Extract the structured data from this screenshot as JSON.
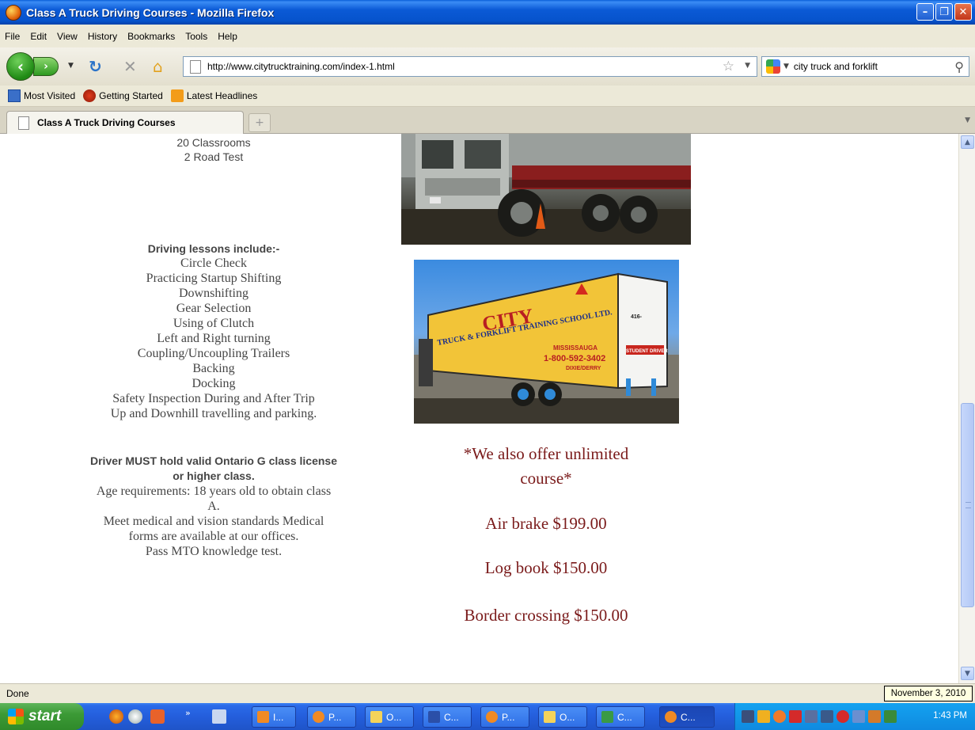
{
  "window": {
    "title": "Class A Truck Driving Courses - Mozilla Firefox"
  },
  "menu": [
    "File",
    "Edit",
    "View",
    "History",
    "Bookmarks",
    "Tools",
    "Help"
  ],
  "nav": {
    "url": "http://www.citytrucktraining.com/index-1.html",
    "search_value": "city truck and forklift"
  },
  "bookmarks": [
    "Most Visited",
    "Getting Started",
    "Latest Headlines"
  ],
  "tab": {
    "label": "Class A Truck Driving Courses"
  },
  "page": {
    "header_lines": [
      "20 Classrooms",
      "2 Road Test"
    ],
    "lessons_title": "Driving lessons include:-",
    "lessons": [
      "Circle Check",
      "Practicing Startup Shifting",
      "Downshifting",
      "Gear Selection",
      "Using of Clutch",
      "Left and Right turning",
      "Coupling/Uncoupling Trailers",
      "Backing",
      "Docking",
      "Safety Inspection During and After Trip",
      "Up and Downhill travelling and parking."
    ],
    "req_bold_1": "Driver MUST hold valid Ontario G class license",
    "req_bold_2": "or higher class.",
    "req_lines": [
      "Age requirements: 18 years old to obtain class",
      "A.",
      "Meet medical and vision standards Medical",
      "forms are available at our offices.",
      "Pass MTO knowledge test."
    ],
    "offer_line_1": "*We also offer unlimited",
    "offer_line_2": "course*",
    "prices": [
      "Air brake $199.00",
      "Log book $150.00",
      "Border crossing $150.00"
    ],
    "trailer_sign": {
      "name": "CITY",
      "sub": "TRUCK & FORKLIFT TRAINING SCHOOL LTD.",
      "city": "MISSISSAUGA",
      "phone": "1-800-592-3402",
      "loc": "DIXIE/DERRY",
      "local_phone": "416-",
      "side": "STUDENT DRIVER"
    }
  },
  "status": {
    "text": "Done",
    "tooltip": "November 3, 2010"
  },
  "taskbar": {
    "start": "start",
    "tasks": [
      "I...",
      "P...",
      "O...",
      "C...",
      "P...",
      "O...",
      "C...",
      "C..."
    ],
    "clock": "1:43 PM"
  }
}
